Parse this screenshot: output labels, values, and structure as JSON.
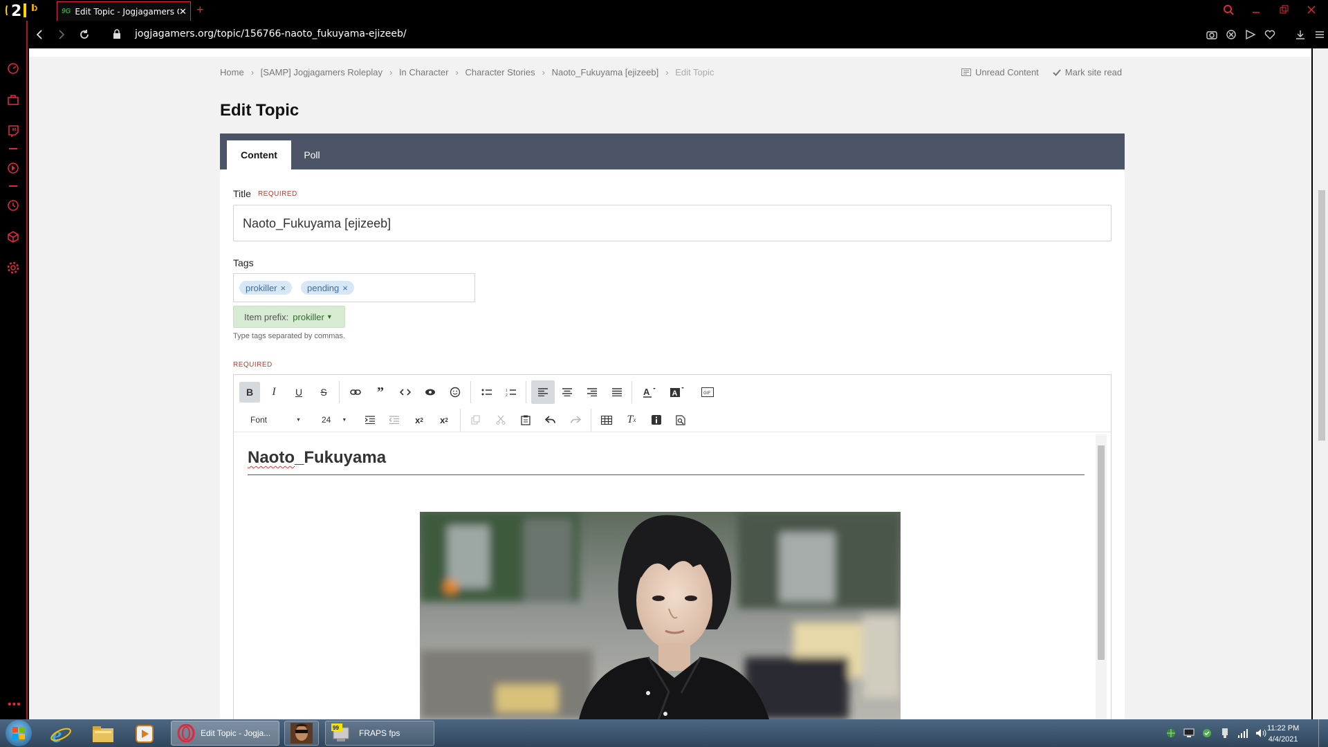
{
  "browser": {
    "tab_title": "Edit Topic - Jogjagamers C",
    "tab_favicon": "9G",
    "url": "jogjagamers.org/topic/156766-naoto_fukuyama-ejizeeb/",
    "logo_text": "21"
  },
  "breadcrumb": {
    "items": [
      "Home",
      "[SAMP] Jogjagamers Roleplay",
      "In Character",
      "Character Stories",
      "Naoto_Fukuyama [ejizeeb]",
      "Edit Topic"
    ]
  },
  "top_links": {
    "unread": "Unread Content",
    "mark_read": "Mark site read"
  },
  "page_title": "Edit Topic",
  "tabs": [
    {
      "label": "Content",
      "active": true
    },
    {
      "label": "Poll",
      "active": false
    }
  ],
  "form": {
    "title_label": "Title",
    "required_text": "REQUIRED",
    "title_value": "Naoto_Fukuyama [ejizeeb]",
    "tags_label": "Tags",
    "tags": [
      "prokiller",
      "pending"
    ],
    "tag_remove": "×",
    "prefix_label": "Item prefix:",
    "prefix_value": "prokiller",
    "tags_hint": "Type tags separated by commas.",
    "editor_required": "REQUIRED"
  },
  "editor": {
    "font_select": "Font",
    "size_select": "24",
    "toolbar_icons": [
      "bold-icon",
      "italic-icon",
      "underline-icon",
      "strikethrough-icon",
      "link-icon",
      "quote-icon",
      "code-icon",
      "spoiler-icon",
      "emoji-icon",
      "bullet-list-icon",
      "numbered-list-icon",
      "align-left-icon",
      "align-center-icon",
      "align-right-icon",
      "justify-icon",
      "text-color-icon",
      "background-color-icon",
      "gif-icon"
    ],
    "heading_part1": "Naoto",
    "heading_part2": "_Fukuyama"
  },
  "taskbar": {
    "opera_label": "Edit Topic - Jogja...",
    "fraps_label": "FRAPS fps",
    "time": "11:22 PM",
    "date": "4/4/2021"
  },
  "colors": {
    "accent": "#e0283c",
    "tab_bar": "#4c5567",
    "tag_bg": "#d7e7f5",
    "prefix_bg": "#d7ecd3",
    "required": "#c0392b"
  }
}
